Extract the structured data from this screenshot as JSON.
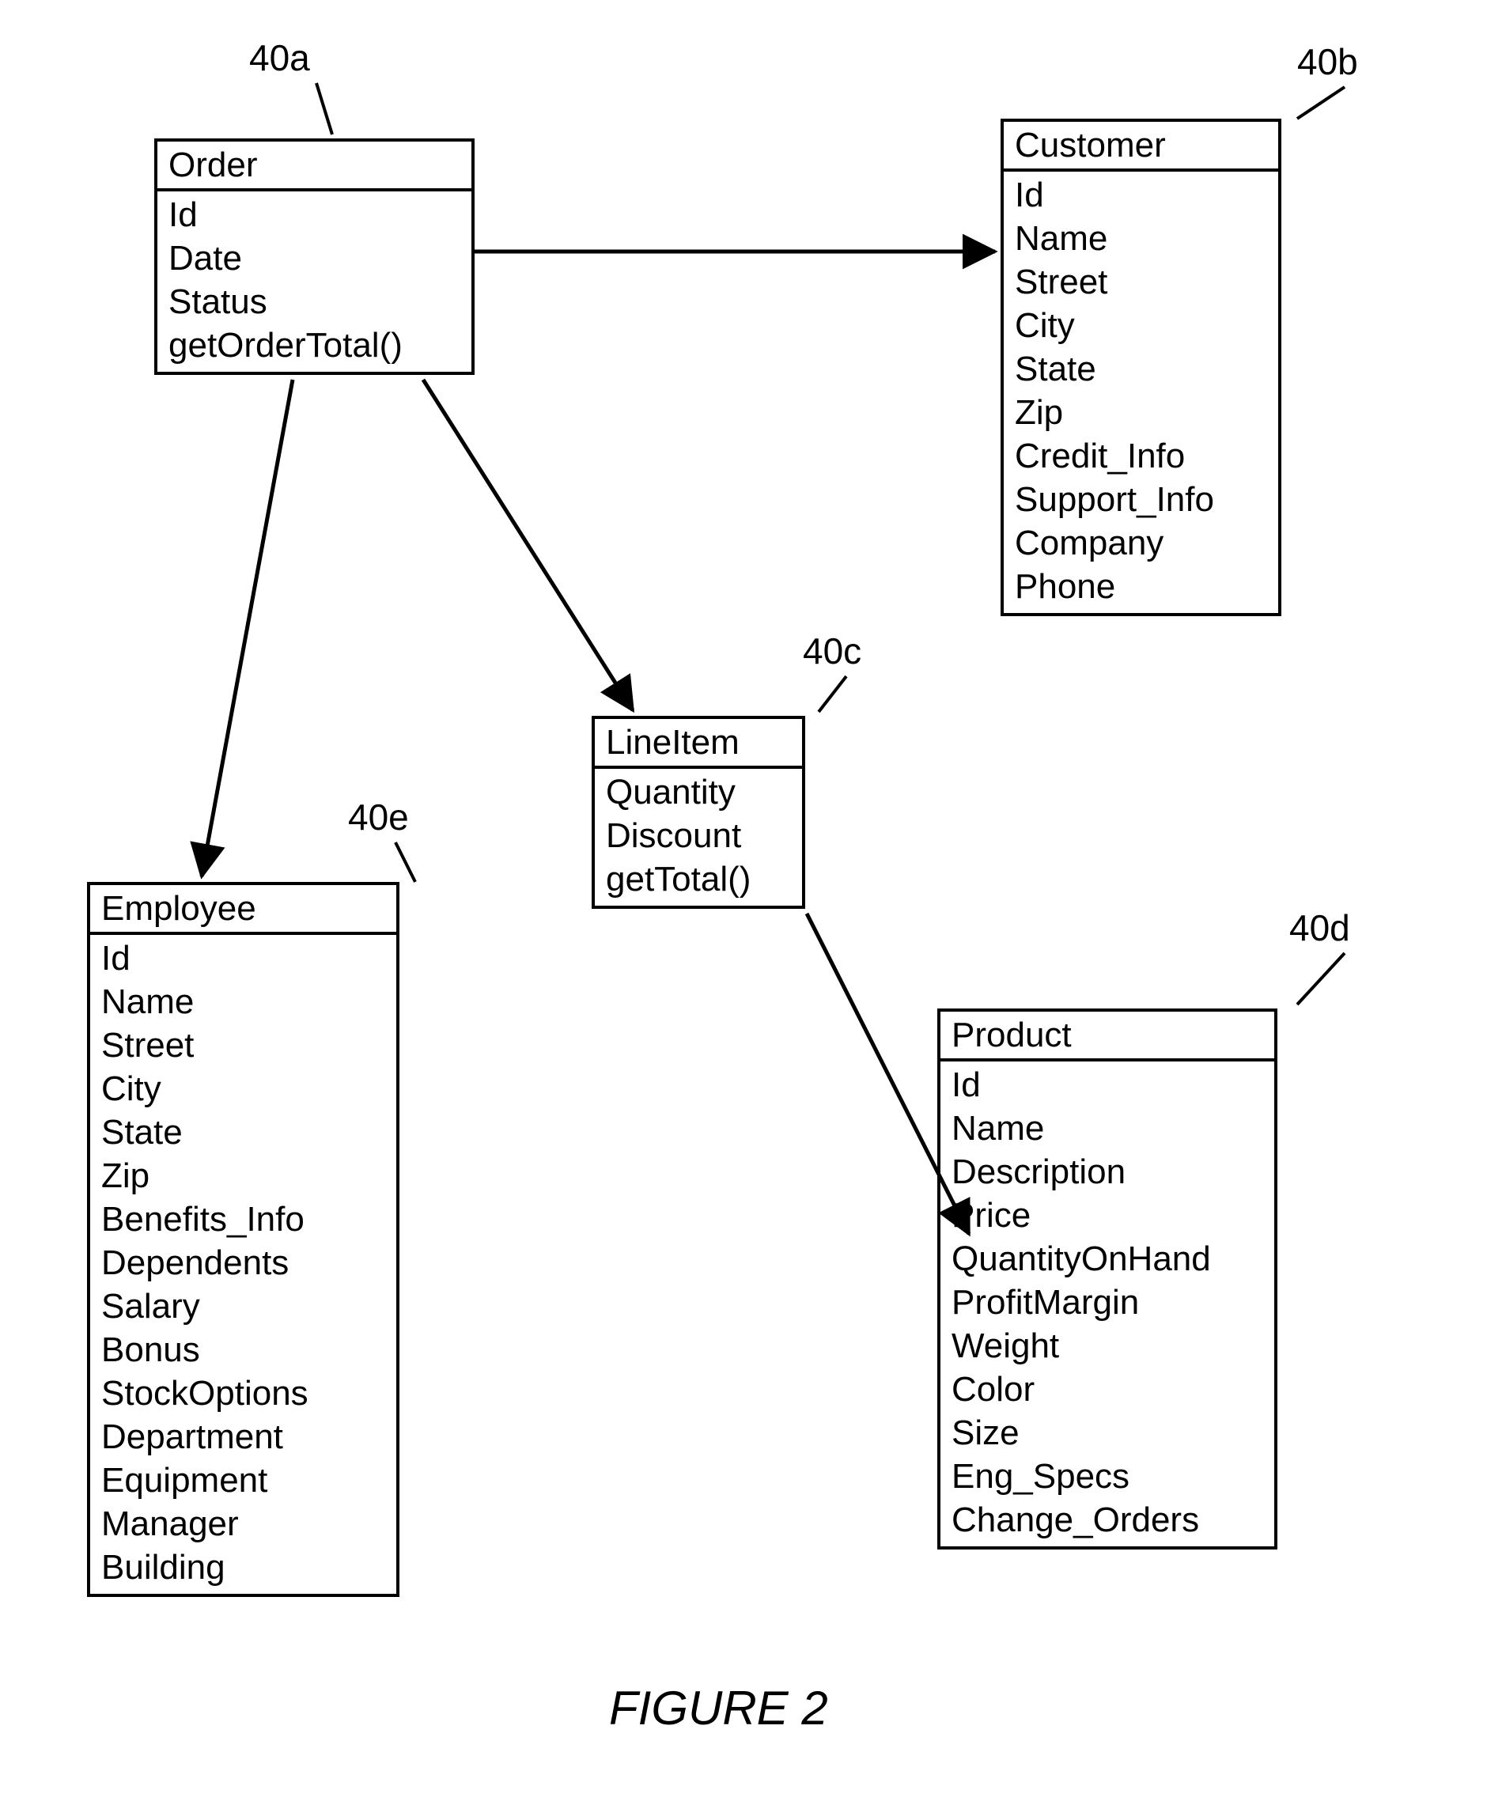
{
  "figure_caption": "FIGURE 2",
  "labels": {
    "order": "40a",
    "customer": "40b",
    "lineitem": "40c",
    "product": "40d",
    "employee": "40e"
  },
  "entities": {
    "order": {
      "title": "Order",
      "attrs": [
        "Id",
        "Date",
        "Status",
        "getOrderTotal()"
      ]
    },
    "customer": {
      "title": "Customer",
      "attrs": [
        "Id",
        "Name",
        "Street",
        "City",
        "State",
        "Zip",
        "Credit_Info",
        "Support_Info",
        "Company",
        "Phone"
      ]
    },
    "lineitem": {
      "title": "LineItem",
      "attrs": [
        "Quantity",
        "Discount",
        "getTotal()"
      ]
    },
    "employee": {
      "title": "Employee",
      "attrs": [
        "Id",
        "Name",
        "Street",
        "City",
        "State",
        "Zip",
        "Benefits_Info",
        "Dependents",
        "Salary",
        "Bonus",
        "StockOptions",
        "Department",
        "Equipment",
        "Manager",
        "Building"
      ]
    },
    "product": {
      "title": "Product",
      "attrs": [
        "Id",
        "Name",
        "Description",
        "Price",
        "QuantityOnHand",
        "ProfitMargin",
        "Weight",
        "Color",
        "Size",
        "Eng_Specs",
        "Change_Orders"
      ]
    }
  }
}
